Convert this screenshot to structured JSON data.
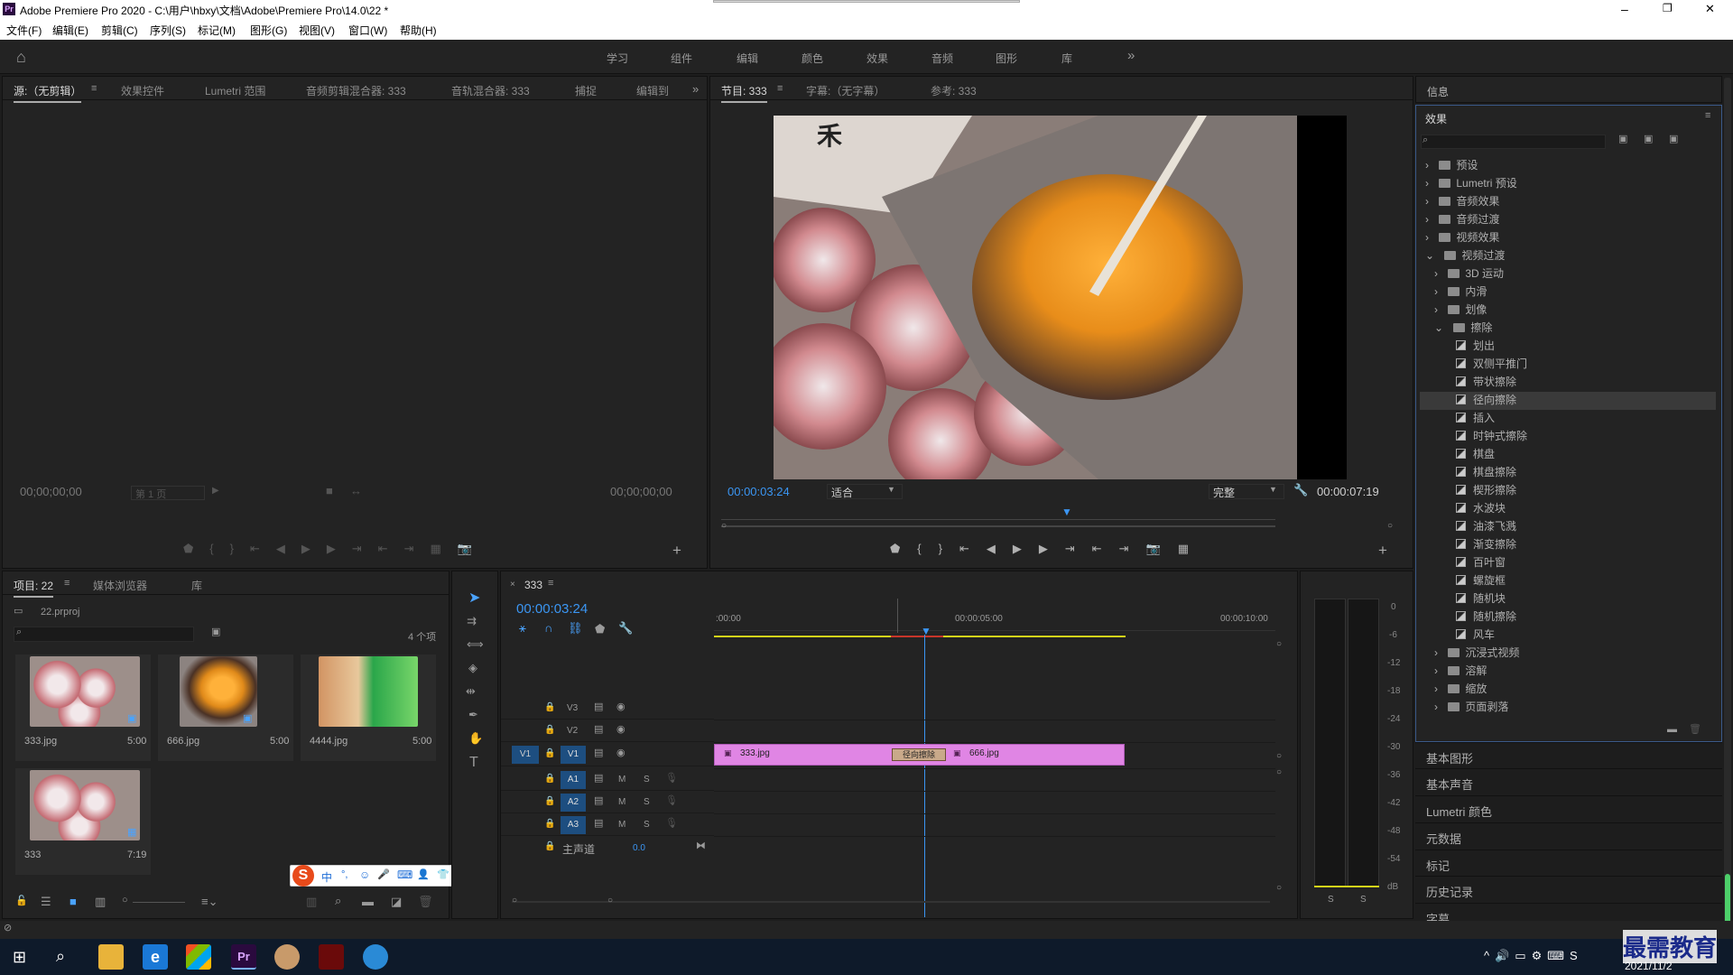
{
  "window": {
    "app_icon": "Pr",
    "title": "Adobe Premiere Pro 2020 - C:\\用户\\hbxy\\文档\\Adobe\\Premiere Pro\\14.0\\22 *",
    "min": "–",
    "max": "❐",
    "close": "✕"
  },
  "menu": [
    "文件(F)",
    "编辑(E)",
    "剪辑(C)",
    "序列(S)",
    "标记(M)",
    "图形(G)",
    "视图(V)",
    "窗口(W)",
    "帮助(H)"
  ],
  "workspaces": [
    "学习",
    "组件",
    "编辑",
    "颜色",
    "效果",
    "音频",
    "图形",
    "库"
  ],
  "source_panel": {
    "tabs": [
      "源:（无剪辑）",
      "效果控件",
      "Lumetri 范围",
      "音频剪辑混合器: 333",
      "音轨混合器: 333",
      "捕捉",
      "编辑到"
    ],
    "tc_left": "00;00;00;00",
    "tc_right": "00;00;00;00",
    "page": "第 1 页"
  },
  "program_panel": {
    "tabs": [
      "节目: 333",
      "字幕:（无字幕）",
      "参考: 333"
    ],
    "tc_left": "00:00:03:24",
    "fit": "适合",
    "quality": "完整",
    "tc_right": "00:00:07:19"
  },
  "info_panel": {
    "title": "信息"
  },
  "effects_panel": {
    "title": "效果",
    "top": [
      "预设",
      "Lumetri 预设",
      "音频效果",
      "音频过渡",
      "视频效果",
      "视频过渡"
    ],
    "video_transitions": [
      "3D 运动",
      "内滑",
      "划像",
      "擦除"
    ],
    "wipe_items": [
      "划出",
      "双侧平推门",
      "带状擦除",
      "径向擦除",
      "插入",
      "时钟式擦除",
      "棋盘",
      "棋盘擦除",
      "楔形擦除",
      "水波块",
      "油漆飞溅",
      "渐变擦除",
      "百叶窗",
      "螺旋框",
      "随机块",
      "随机擦除",
      "风车"
    ],
    "selected": "径向擦除",
    "after": [
      "沉浸式视频",
      "溶解",
      "缩放",
      "页面剥落"
    ]
  },
  "side_panels": [
    "基本图形",
    "基本声音",
    "Lumetri 颜色",
    "元数据",
    "标记",
    "历史记录",
    "字幕"
  ],
  "project_panel": {
    "tabs": [
      "项目: 22",
      "媒体浏览器",
      "库"
    ],
    "file": "22.prproj",
    "count": "4 个项",
    "items": [
      {
        "name": "333.jpg",
        "dur": "5:00"
      },
      {
        "name": "666.jpg",
        "dur": "5:00"
      },
      {
        "name": "4444.jpg",
        "dur": "5:00"
      },
      {
        "name": "333",
        "dur": "7:19"
      }
    ]
  },
  "timeline": {
    "tab": "333",
    "tc": "00:00:03:24",
    "ruler": [
      ":00:00",
      "00:00:05:00",
      "00:00:10:00"
    ],
    "tracks_v": [
      "V3",
      "V2",
      "V1"
    ],
    "tracks_a": [
      "A1",
      "A2",
      "A3"
    ],
    "src_v": "V1",
    "m": "M",
    "s": "S",
    "master": "主声道",
    "master_val": "0.0",
    "clip1": "333.jpg",
    "clip2": "666.jpg",
    "transition": "径向擦除"
  },
  "meter": {
    "scale": [
      "0",
      "-6",
      "-12",
      "-18",
      "-24",
      "-30",
      "-36",
      "-42",
      "-48",
      "-54",
      "dB"
    ],
    "s1": "S",
    "s2": "S"
  },
  "ime": {
    "logo": "S",
    "items": [
      "中",
      "°,",
      "☺",
      "🎤",
      "⌨",
      "👤",
      "👕",
      "▦"
    ]
  },
  "taskbar": {
    "date": "2021/11/2",
    "watermark": "最需教育",
    "pr": "Pr",
    "e": "e"
  },
  "colors": {
    "accent": "#3b96f3",
    "clip": "#e085e4",
    "selected_bg": "#3a3a3a"
  }
}
